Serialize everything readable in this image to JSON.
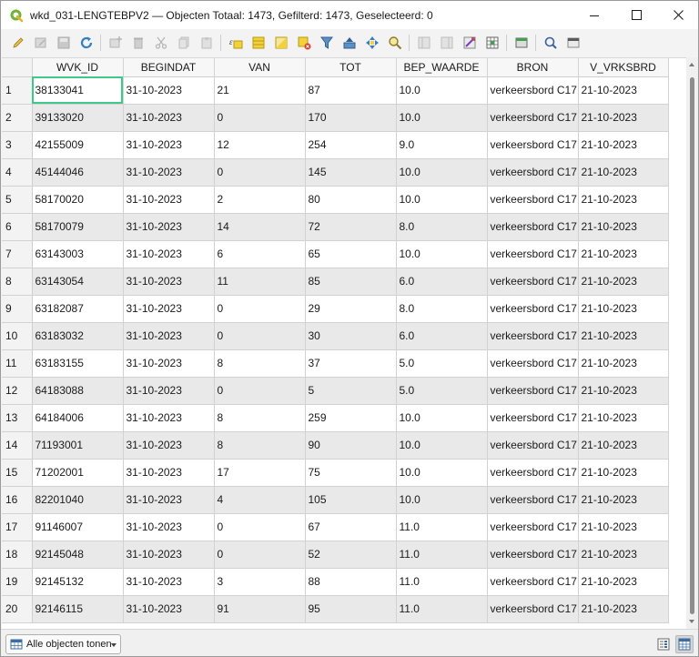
{
  "window": {
    "title": "wkd_031-LENGTEBPV2 — Objecten Totaal: 1473, Gefilterd: 1473, Geselecteerd: 0",
    "app_icon": "qgis-icon"
  },
  "toolbar": {
    "icons": [
      "edit-pencil-icon",
      "multi-edit-icon",
      "save-edits-icon",
      "reload-icon",
      "add-feature-icon",
      "delete-feature-icon",
      "cut-icon",
      "copy-icon",
      "paste-icon",
      "expression-select-icon",
      "select-all-icon",
      "invert-selection-icon",
      "deselect-all-icon",
      "filter-selection-icon",
      "move-selection-top-icon",
      "pan-to-selection-icon",
      "zoom-to-selection-icon",
      "new-field-icon",
      "delete-field-icon",
      "field-calculator-icon",
      "conditional-formatting-icon",
      "dock-icon",
      "actions-icon",
      "layout-icon"
    ]
  },
  "table": {
    "columns": [
      "WVK_ID",
      "BEGINDAT",
      "VAN",
      "TOT",
      "BEP_WAARDE",
      "BRON",
      "V_VRKSBRD"
    ],
    "rows": [
      [
        "1",
        "38133041",
        "31-10-2023",
        "21",
        "87",
        "10.0",
        "verkeersbord C17",
        "21-10-2023"
      ],
      [
        "2",
        "39133020",
        "31-10-2023",
        "0",
        "170",
        "10.0",
        "verkeersbord C17",
        "21-10-2023"
      ],
      [
        "3",
        "42155009",
        "31-10-2023",
        "12",
        "254",
        "9.0",
        "verkeersbord C17",
        "21-10-2023"
      ],
      [
        "4",
        "45144046",
        "31-10-2023",
        "0",
        "145",
        "10.0",
        "verkeersbord C17",
        "21-10-2023"
      ],
      [
        "5",
        "58170020",
        "31-10-2023",
        "2",
        "80",
        "10.0",
        "verkeersbord C17",
        "21-10-2023"
      ],
      [
        "6",
        "58170079",
        "31-10-2023",
        "14",
        "72",
        "8.0",
        "verkeersbord C17",
        "21-10-2023"
      ],
      [
        "7",
        "63143003",
        "31-10-2023",
        "6",
        "65",
        "10.0",
        "verkeersbord C17",
        "21-10-2023"
      ],
      [
        "8",
        "63143054",
        "31-10-2023",
        "11",
        "85",
        "6.0",
        "verkeersbord C17",
        "21-10-2023"
      ],
      [
        "9",
        "63182087",
        "31-10-2023",
        "0",
        "29",
        "8.0",
        "verkeersbord C17",
        "21-10-2023"
      ],
      [
        "10",
        "63183032",
        "31-10-2023",
        "0",
        "30",
        "6.0",
        "verkeersbord C17",
        "21-10-2023"
      ],
      [
        "11",
        "63183155",
        "31-10-2023",
        "8",
        "37",
        "5.0",
        "verkeersbord C17",
        "21-10-2023"
      ],
      [
        "12",
        "64183088",
        "31-10-2023",
        "0",
        "5",
        "5.0",
        "verkeersbord C17",
        "21-10-2023"
      ],
      [
        "13",
        "64184006",
        "31-10-2023",
        "8",
        "259",
        "10.0",
        "verkeersbord C17",
        "21-10-2023"
      ],
      [
        "14",
        "71193001",
        "31-10-2023",
        "8",
        "90",
        "10.0",
        "verkeersbord C17",
        "21-10-2023"
      ],
      [
        "15",
        "71202001",
        "31-10-2023",
        "17",
        "75",
        "10.0",
        "verkeersbord C17",
        "21-10-2023"
      ],
      [
        "16",
        "82201040",
        "31-10-2023",
        "4",
        "105",
        "10.0",
        "verkeersbord C17",
        "21-10-2023"
      ],
      [
        "17",
        "91146007",
        "31-10-2023",
        "0",
        "67",
        "11.0",
        "verkeersbord C17",
        "21-10-2023"
      ],
      [
        "18",
        "92145048",
        "31-10-2023",
        "0",
        "52",
        "11.0",
        "verkeersbord C17",
        "21-10-2023"
      ],
      [
        "19",
        "92145132",
        "31-10-2023",
        "3",
        "88",
        "11.0",
        "verkeersbord C17",
        "21-10-2023"
      ],
      [
        "20",
        "92146115",
        "31-10-2023",
        "91",
        "95",
        "11.0",
        "verkeersbord C17",
        "21-10-2023"
      ]
    ],
    "selected_cell": {
      "row": 0,
      "col": 0
    }
  },
  "bottombar": {
    "filter_label": "Alle objecten tonen",
    "filter_icon": "table-filter-icon",
    "view_form_icon": "form-view-icon",
    "view_table_icon": "table-view-icon"
  },
  "colors": {
    "selected_outline": "#3cc98a",
    "alt_row": "#e9e9e9"
  }
}
